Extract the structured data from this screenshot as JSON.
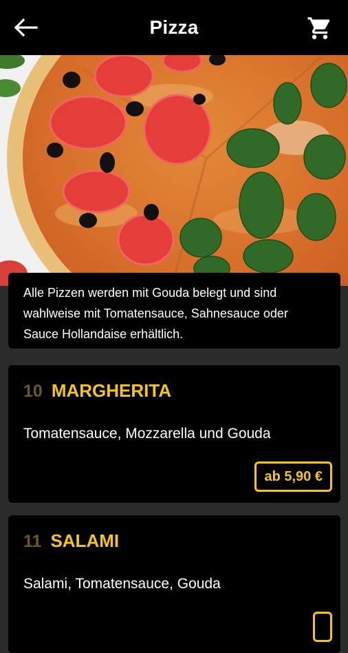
{
  "header": {
    "title": "Pizza",
    "back_icon": "arrow-left-icon",
    "cart_icon": "cart-icon"
  },
  "hero": {
    "image": "pizza-photo"
  },
  "info": {
    "text": "Alle Pizzen werden mit Gouda belegt und sind wahlweise mit Tomatensauce, Sahnesauce oder Sauce Hollandaise erhältlich."
  },
  "products": [
    {
      "number": "10",
      "name": "MARGHERITA",
      "description": "Tomatensauce, Mozzarella und Gouda",
      "price": "ab 5,90 €"
    },
    {
      "number": "11",
      "name": "SALAMI",
      "description": "Salami, Tomatensauce, Gouda",
      "price": ""
    }
  ],
  "colors": {
    "accent": "#f5c518",
    "number": "#6a5a22",
    "background": "#2b2b2b",
    "card": "#000000"
  }
}
